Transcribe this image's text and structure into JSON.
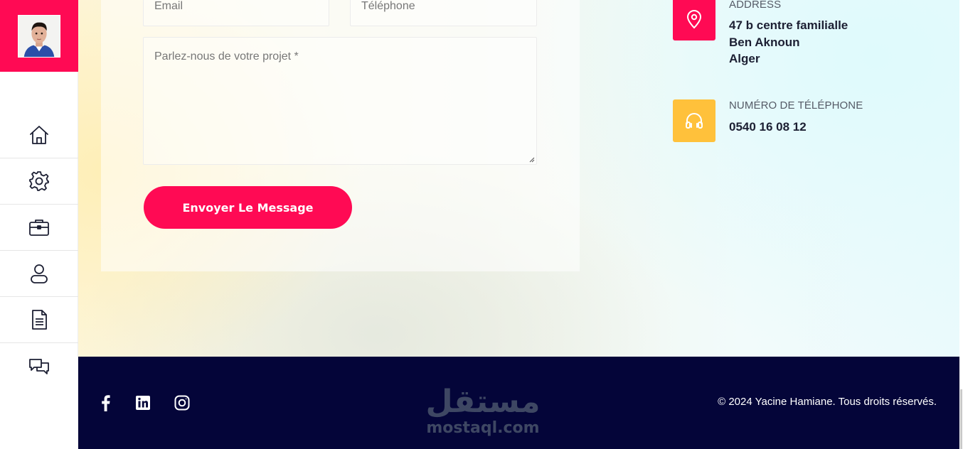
{
  "sidebar": {
    "nav": [
      {
        "name": "home",
        "icon": "home-icon"
      },
      {
        "name": "services",
        "icon": "gear-icon"
      },
      {
        "name": "portfolio",
        "icon": "briefcase-icon"
      },
      {
        "name": "about",
        "icon": "user-icon"
      },
      {
        "name": "resume",
        "icon": "document-icon"
      },
      {
        "name": "contact",
        "icon": "chat-icon"
      }
    ]
  },
  "form": {
    "email_placeholder": "Email",
    "phone_placeholder": "Téléphone",
    "message_placeholder": "Parlez-nous de votre projet *",
    "submit_label": "Envoyer Le Message"
  },
  "contact_info": {
    "address": {
      "label": "ADDRESS",
      "lines": [
        "47 b centre familialle",
        "Ben Aknoun",
        "Alger"
      ],
      "icon": "map-pin-icon"
    },
    "phone": {
      "label": "NUMÉRO DE TÉLÉPHONE",
      "value": "0540 16 08 12",
      "icon": "headphones-icon"
    }
  },
  "footer": {
    "social": [
      "facebook-icon",
      "linkedin-icon",
      "instagram-icon"
    ],
    "watermark_logo": "مستقل",
    "watermark_url": "mostaql.com",
    "copyright": "© 2024 Yacine Hamiane. Tous droits réservés."
  },
  "colors": {
    "accent": "#ff0a54",
    "yellow": "#ffc13b",
    "footer_bg": "#040539"
  }
}
